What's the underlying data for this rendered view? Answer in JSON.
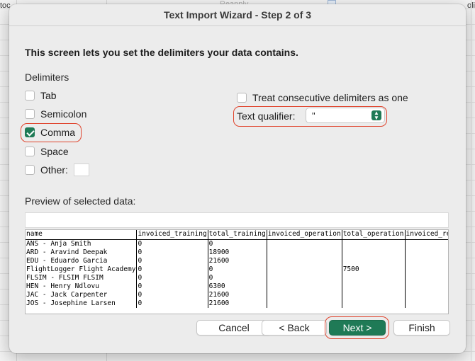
{
  "background": {
    "left_text": "toc",
    "right_text": "oli",
    "mid_text": "Reapply"
  },
  "dialog": {
    "title": "Text Import Wizard - Step 2 of 3",
    "heading": "This screen lets you set the delimiters your data contains.",
    "delimiters_label": "Delimiters",
    "delimiters": {
      "tab": {
        "label": "Tab",
        "checked": false
      },
      "semicolon": {
        "label": "Semicolon",
        "checked": false
      },
      "comma": {
        "label": "Comma",
        "checked": true
      },
      "space": {
        "label": "Space",
        "checked": false
      },
      "other": {
        "label": "Other:",
        "checked": false,
        "value": ""
      }
    },
    "consecutive": {
      "label": "Treat consecutive delimiters as one",
      "checked": false
    },
    "text_qualifier": {
      "label": "Text qualifier:",
      "value": "\""
    },
    "preview_label": "Preview of selected data:",
    "preview": {
      "headers": [
        "name",
        "invoiced_training",
        "total_training",
        "invoiced_operation",
        "total_operation",
        "invoiced_rer"
      ],
      "rows": [
        [
          "ANS - Anja Smith",
          "0",
          "0",
          "",
          "",
          ""
        ],
        [
          "ARD - Aravind Deepak",
          "0",
          "18900",
          "",
          "",
          ""
        ],
        [
          "EDU - Eduardo Garcia",
          "0",
          "21600",
          "",
          "",
          ""
        ],
        [
          "FlightLogger Flight Academy",
          "0",
          "0",
          "",
          "7500",
          ""
        ],
        [
          "FLSIM - FLSIM FLSIM",
          "0",
          "0",
          "",
          "",
          ""
        ],
        [
          "HEN - Henry Ndlovu",
          "0",
          "6300",
          "",
          "",
          ""
        ],
        [
          "JAC - Jack Carpenter",
          "0",
          "21600",
          "",
          "",
          ""
        ],
        [
          "JOS - Josephine Larsen",
          "0",
          "21600",
          "",
          "",
          ""
        ]
      ]
    },
    "buttons": {
      "cancel": "Cancel",
      "back": "< Back",
      "next": "Next >",
      "finish": "Finish"
    }
  },
  "colors": {
    "accent": "#1f7a56",
    "highlight": "#e0452e"
  }
}
